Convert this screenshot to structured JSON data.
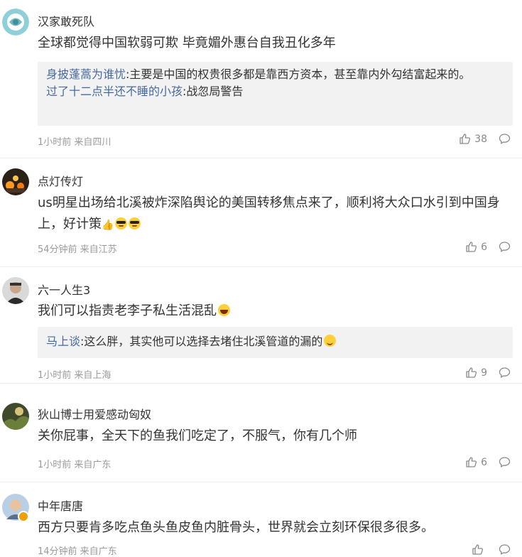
{
  "comments": [
    {
      "username": "汉家敢死队",
      "text": "全球都觉得中国软弱可欺 毕竟媚外惠台自我丑化多年",
      "replies": [
        {
          "name": "身披蓬蒿为谁忧",
          "text": ":主要是中国的权贵很多都是靠西方资本，甚至靠内外勾结富起来的。"
        },
        {
          "name": "过了十二点半还不睡的小孩",
          "text": ":战忽局警告"
        }
      ],
      "time": "1小时前 来自四川",
      "likes": "38"
    },
    {
      "username": "点灯传灯",
      "text": "us明星出场给北溪被炸深陷舆论的美国转移焦点来了，顺利将大众口水引到中国身上，好计策",
      "emojis": [
        "thumb",
        "cool",
        "cool"
      ],
      "time": "54分钟前 来自江苏",
      "likes": "6"
    },
    {
      "username": "六一人生3",
      "text": "我们可以指责老李子私生活混乱",
      "emojis": [
        "laugh"
      ],
      "replies": [
        {
          "name": "马上谈",
          "text": ":这么胖，其实他可以选择去堵住北溪管道的漏的"
        }
      ],
      "time": "1小时前 来自上海",
      "likes": "9"
    },
    {
      "username": "狄山博士用爱感动匈奴",
      "text": "关你屁事，全天下的鱼我们吃定了，不服气，你有几个师",
      "time": "1小时前 来自广东",
      "likes": "6"
    },
    {
      "username": "中年唐唐",
      "text": "西方只要肯多吃点鱼头鱼皮鱼内脏骨头，世界就会立刻环保很多很多。",
      "time": "14分钟前 来自广东",
      "likes": ""
    }
  ],
  "icons": {
    "like": "thumbs-up-outline-icon",
    "comment": "speech-bubble-icon"
  },
  "colors": {
    "reply_name": "#476a9e",
    "reply_bg": "#f2f2f2",
    "meta": "#9b9b9b"
  }
}
